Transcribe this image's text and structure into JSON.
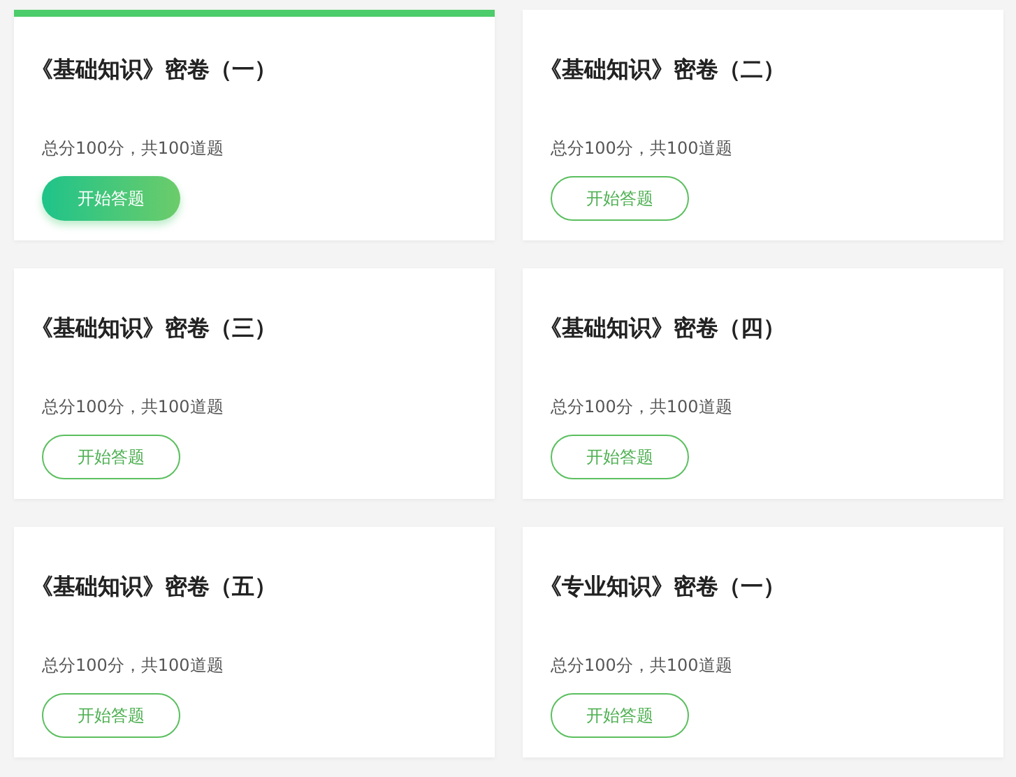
{
  "papers": [
    {
      "title": "《基础知识》密卷（一）",
      "summary": "总分100分，共100道题",
      "button": "开始答题",
      "selected": true
    },
    {
      "title": "《基础知识》密卷（二）",
      "summary": "总分100分，共100道题",
      "button": "开始答题",
      "selected": false
    },
    {
      "title": "《基础知识》密卷（三）",
      "summary": "总分100分，共100道题",
      "button": "开始答题",
      "selected": false
    },
    {
      "title": "《基础知识》密卷（四）",
      "summary": "总分100分，共100道题",
      "button": "开始答题",
      "selected": false
    },
    {
      "title": "《基础知识》密卷（五）",
      "summary": "总分100分，共100道题",
      "button": "开始答题",
      "selected": false
    },
    {
      "title": "《专业知识》密卷（一）",
      "summary": "总分100分，共100道题",
      "button": "开始答题",
      "selected": false
    }
  ]
}
